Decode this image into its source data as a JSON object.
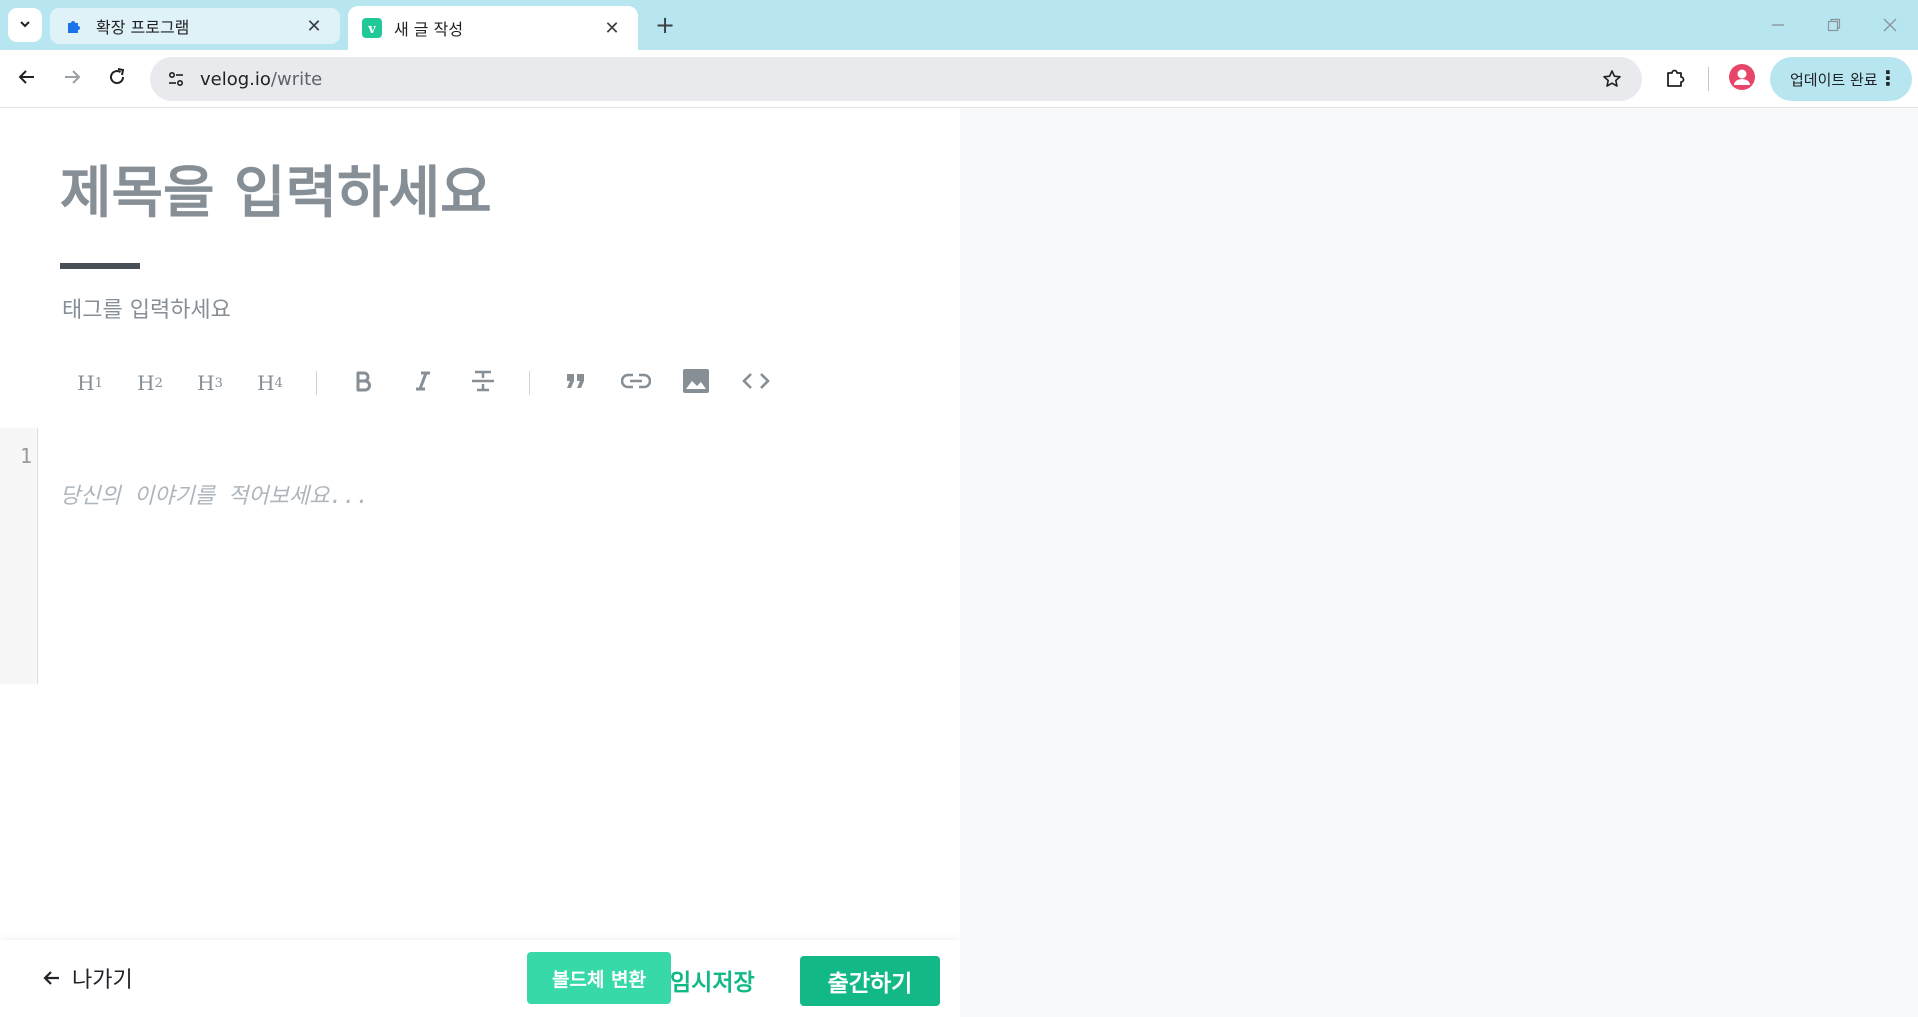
{
  "browser": {
    "tabs": [
      {
        "label": "확장 프로그램",
        "active": false,
        "favicon": "puzzle-icon"
      },
      {
        "label": "새 글 작성",
        "active": true,
        "favicon": "velog-logo-icon",
        "favicon_letter": "v"
      }
    ],
    "url_host": "velog.io",
    "url_path": "/write",
    "update_label": "업데이트 완료"
  },
  "editor": {
    "title_placeholder": "제목을 입력하세요",
    "tag_placeholder": "태그를 입력하세요",
    "toolbar": {
      "h1": "H",
      "h1_sub": "1",
      "h2": "H",
      "h2_sub": "2",
      "h3": "H",
      "h3_sub": "3",
      "h4": "H",
      "h4_sub": "4"
    },
    "line_number": "1",
    "body_placeholder": "당신의 이야기를 적어보세요..."
  },
  "footer": {
    "exit_label": "나가기",
    "bold_convert_label": "볼드체 변환",
    "save_label": "임시저장",
    "publish_label": "출간하기"
  },
  "colors": {
    "brand": "#12b886",
    "brand_light": "#38d9a9",
    "chrome_accent": "#b7e6f0",
    "preview_bg": "#f8f9fa"
  }
}
